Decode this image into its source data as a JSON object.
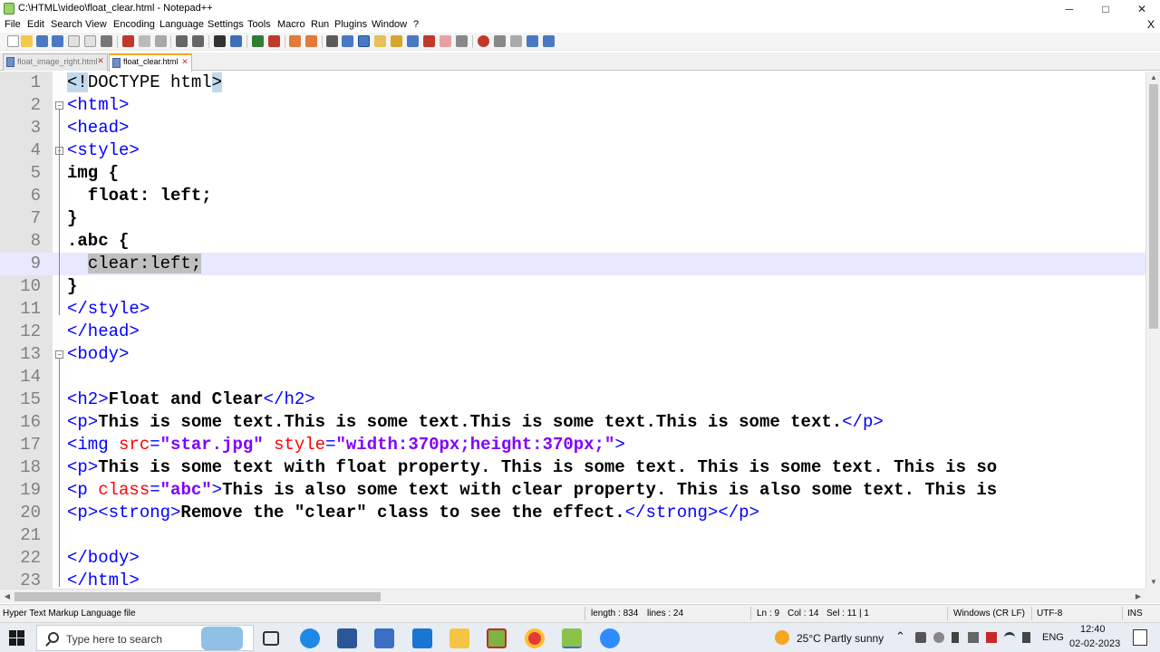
{
  "window": {
    "title": "C:\\HTML\\video\\float_clear.html - Notepad++",
    "minimize": "─",
    "maximize": "□",
    "close": "✕"
  },
  "menu": {
    "items": [
      "File",
      "Edit",
      "Search",
      "View",
      "Encoding",
      "Language",
      "Settings",
      "Tools",
      "Macro",
      "Run",
      "Plugins",
      "Window",
      "?"
    ],
    "close": "X"
  },
  "tabs": [
    {
      "label": "float_image_right.html",
      "active": false
    },
    {
      "label": "float_clear.html",
      "active": true
    }
  ],
  "editor": {
    "current_line": 9,
    "fold_markers": {
      "2": "⊟",
      "4": "⊟",
      "13": "⊟"
    },
    "lines": [
      {
        "n": "1",
        "segs": [
          [
            "brace",
            "<!"
          ],
          [
            "plain",
            "DOCTYPE html"
          ],
          [
            "brace",
            ">"
          ]
        ]
      },
      {
        "n": "2",
        "segs": [
          [
            "tag",
            "<html>"
          ]
        ]
      },
      {
        "n": "3",
        "segs": [
          [
            "tag",
            "<head>"
          ]
        ]
      },
      {
        "n": "4",
        "segs": [
          [
            "tag",
            "<style>"
          ]
        ]
      },
      {
        "n": "5",
        "segs": [
          [
            "txt",
            "img {"
          ]
        ]
      },
      {
        "n": "6",
        "segs": [
          [
            "txt",
            "  float: left;"
          ]
        ]
      },
      {
        "n": "7",
        "segs": [
          [
            "txt",
            "}"
          ]
        ]
      },
      {
        "n": "8",
        "segs": [
          [
            "txt",
            ".abc {"
          ]
        ]
      },
      {
        "n": "9",
        "segs": [
          [
            "plain",
            "  "
          ],
          [
            "sel",
            "clear:left;"
          ]
        ]
      },
      {
        "n": "10",
        "segs": [
          [
            "txt",
            "}"
          ]
        ]
      },
      {
        "n": "11",
        "segs": [
          [
            "tag",
            "</style>"
          ]
        ]
      },
      {
        "n": "12",
        "segs": [
          [
            "tag",
            "</head>"
          ]
        ]
      },
      {
        "n": "13",
        "segs": [
          [
            "tag",
            "<body>"
          ]
        ]
      },
      {
        "n": "14",
        "segs": []
      },
      {
        "n": "15",
        "segs": [
          [
            "tag",
            "<h2>"
          ],
          [
            "txt",
            "Float and Clear"
          ],
          [
            "tag",
            "</h2>"
          ]
        ]
      },
      {
        "n": "16",
        "segs": [
          [
            "tag",
            "<p>"
          ],
          [
            "txt",
            "This is some text.This is some text.This is some text.This is some text."
          ],
          [
            "tag",
            "</p>"
          ]
        ]
      },
      {
        "n": "17",
        "segs": [
          [
            "tag",
            "<img "
          ],
          [
            "attr",
            "src"
          ],
          [
            "tag",
            "="
          ],
          [
            "val",
            "\"star.jpg\""
          ],
          [
            "plain",
            " "
          ],
          [
            "attr",
            "style"
          ],
          [
            "tag",
            "="
          ],
          [
            "val",
            "\"width:370px;height:370px;\""
          ],
          [
            "tag",
            ">"
          ]
        ]
      },
      {
        "n": "18",
        "segs": [
          [
            "tag",
            "<p>"
          ],
          [
            "txt",
            "This is some text with float property. This is some text. This is some text. This is so"
          ]
        ]
      },
      {
        "n": "19",
        "segs": [
          [
            "tag",
            "<p "
          ],
          [
            "attr",
            "class"
          ],
          [
            "tag",
            "="
          ],
          [
            "val",
            "\"abc\""
          ],
          [
            "tag",
            ">"
          ],
          [
            "txt",
            "This is also some text with clear property. This is also some text. This is"
          ]
        ]
      },
      {
        "n": "20",
        "segs": [
          [
            "tag",
            "<p><strong>"
          ],
          [
            "txt",
            "Remove the \"clear\" class to see the effect."
          ],
          [
            "tag",
            "</strong></p>"
          ]
        ]
      },
      {
        "n": "21",
        "segs": []
      },
      {
        "n": "22",
        "segs": [
          [
            "tag",
            "</body>"
          ]
        ]
      },
      {
        "n": "23",
        "segs": [
          [
            "tag",
            "</html>"
          ]
        ]
      }
    ]
  },
  "status": {
    "file_type": "Hyper Text Markup Language file",
    "length": "length : 834",
    "lines": "lines : 24",
    "ln": "Ln : 9",
    "col": "Col : 14",
    "sel": "Sel : 11 | 1",
    "eol": "Windows (CR LF)",
    "encoding": "UTF-8",
    "mode": "INS"
  },
  "taskbar": {
    "search_placeholder": "Type here to search",
    "weather": "25°C  Partly sunny",
    "language": "ENG",
    "time": "12:40",
    "date": "02-02-2023"
  },
  "colors": {
    "tag": "#0000ff",
    "attr": "#ff0000",
    "value": "#8000ff",
    "current_line": "#e8e8ff",
    "gutter": "#e4e4e4",
    "active_tab_accent": "#f6a623"
  }
}
